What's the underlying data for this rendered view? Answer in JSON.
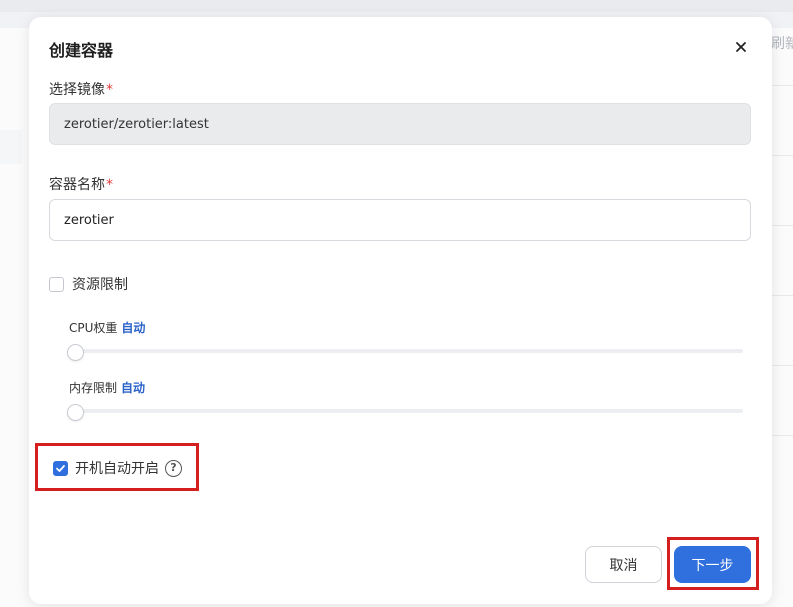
{
  "background": {
    "refresh_text": "刷新"
  },
  "modal": {
    "title": "创建容器",
    "close_symbol": "×",
    "image_field": {
      "label": "选择镜像",
      "required_mark": "*",
      "value": "zerotier/zerotier:latest"
    },
    "name_field": {
      "label": "容器名称",
      "required_mark": "*",
      "value": "zerotier"
    },
    "resource_limit": {
      "label": "资源限制",
      "checked": false
    },
    "cpu_weight": {
      "label": "CPU权重",
      "value_text": "自动",
      "level": 0
    },
    "memory_limit": {
      "label": "内存限制",
      "value_text": "自动",
      "level": 0
    },
    "autostart": {
      "label": "开机自动开启",
      "checked": true,
      "help_symbol": "?"
    },
    "buttons": {
      "cancel": "取消",
      "next": "下一步"
    }
  },
  "colors": {
    "primary": "#2f6fde",
    "auto_text": "#2a62c9",
    "required": "#e03e3e",
    "highlight": "#d41f1f"
  }
}
